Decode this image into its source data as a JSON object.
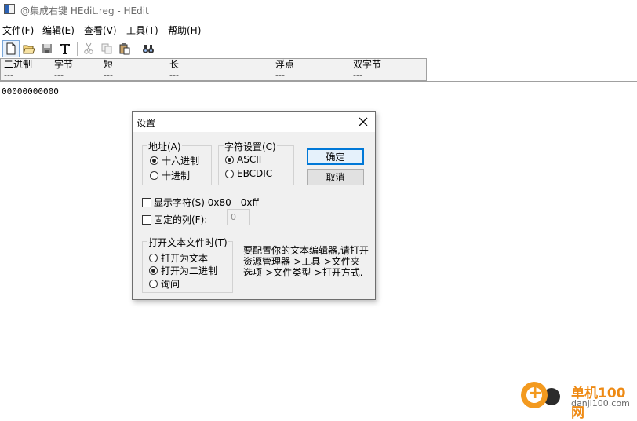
{
  "window": {
    "title": "@集成右键 HEdit.reg - HEdit"
  },
  "menu": [
    "文件(F)",
    "编辑(E)",
    "查看(V)",
    "工具(T)",
    "帮助(H)"
  ],
  "toolbar": {
    "icons": [
      "new-file-icon",
      "open-folder-icon",
      "save-icon",
      "text-icon",
      "cut-icon",
      "copy-icon",
      "paste-icon",
      "find-icon"
    ]
  },
  "inspector": [
    {
      "label": "二进制",
      "value": "---"
    },
    {
      "label": "字节",
      "value": "---"
    },
    {
      "label": "短",
      "value": "---"
    },
    {
      "label": "长",
      "value": "---"
    },
    {
      "label": "浮点",
      "value": "---"
    },
    {
      "label": "双字节",
      "value": "---"
    }
  ],
  "content": {
    "line1": "00000000000"
  },
  "dialog": {
    "title": "设置",
    "address": {
      "label": "地址(A)",
      "options": [
        {
          "label": "十六进制",
          "selected": true
        },
        {
          "label": "十进制",
          "selected": false
        }
      ]
    },
    "charset": {
      "label": "字符设置(C)",
      "options": [
        {
          "label": "ASCII",
          "selected": true
        },
        {
          "label": "EBCDIC",
          "selected": false
        }
      ]
    },
    "ok_label": "确定",
    "cancel_label": "取消",
    "show_chars": {
      "label": "显示字符(S) 0x80 - 0xff",
      "checked": false
    },
    "fixed_cols": {
      "label": "固定的列(F):",
      "checked": false,
      "value": "0"
    },
    "open_text": {
      "label": "打开文本文件时(T)",
      "options": [
        {
          "label": "打开为文本",
          "selected": false
        },
        {
          "label": "打开为二进制",
          "selected": true
        },
        {
          "label": "询问",
          "selected": false
        }
      ]
    },
    "help_text": "要配置你的文本编辑器,请打开资源管理器->工具->文件夹选项->文件类型->打开方式."
  },
  "watermark": {
    "name": "单机100网",
    "url": "danji100.com"
  }
}
